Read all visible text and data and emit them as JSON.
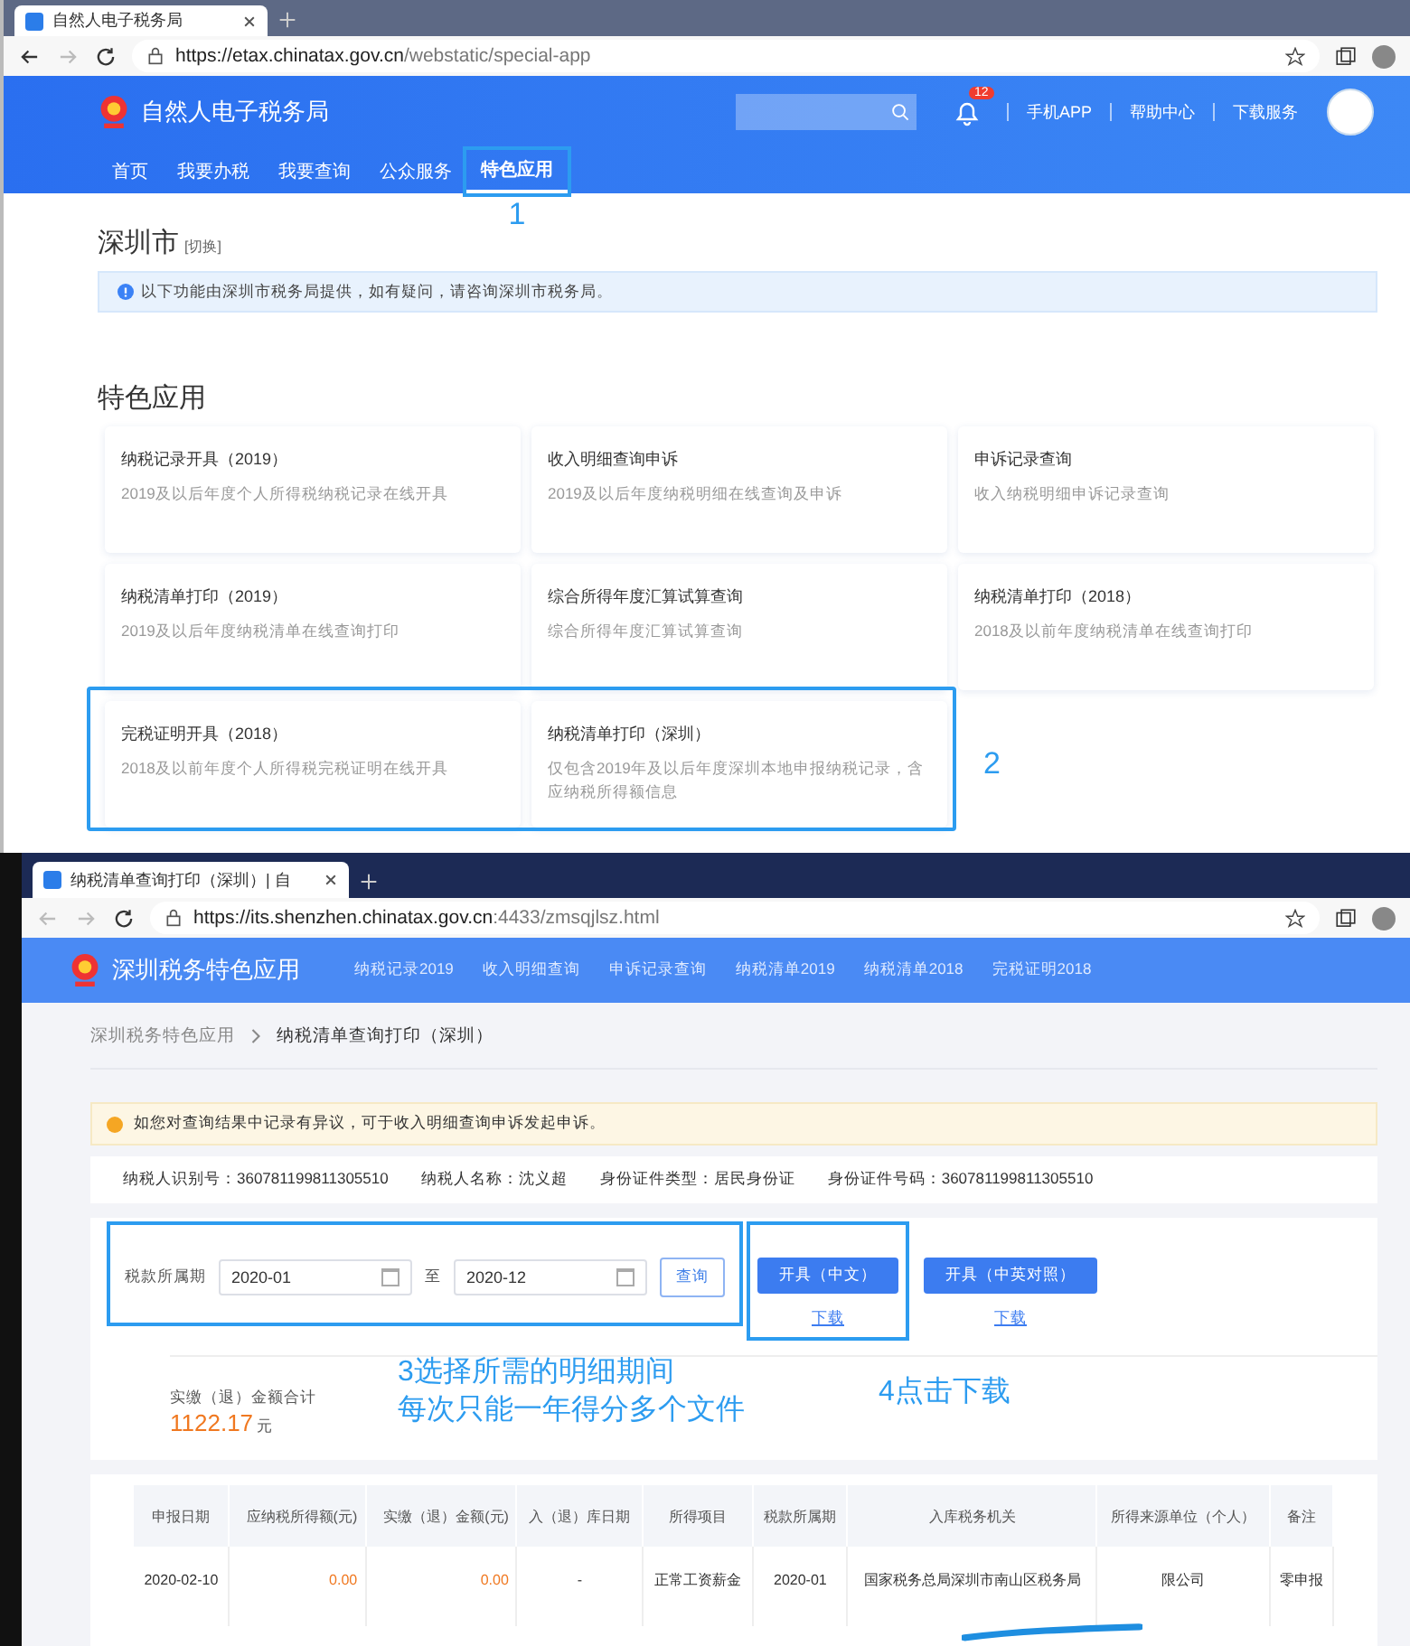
{
  "window_1": {
    "tab_title": "自然人电子税务局",
    "url_host": "https://etax.chinatax.gov.cn",
    "url_path": "/webstatic/special-app"
  },
  "site_1": {
    "title": "自然人电子税务局",
    "notification_count": "12",
    "links": [
      "手机APP",
      "帮助中心",
      "下载服务"
    ],
    "nav": [
      {
        "label": "首页",
        "selected": false,
        "highlighted": false
      },
      {
        "label": "我要办税",
        "selected": false,
        "highlighted": false
      },
      {
        "label": "我要查询",
        "selected": false,
        "highlighted": false
      },
      {
        "label": "公众服务",
        "selected": false,
        "highlighted": false
      },
      {
        "label": "特色应用",
        "selected": true,
        "highlighted": true
      }
    ]
  },
  "city": {
    "name": "深圳市",
    "switch": "[切换]"
  },
  "notice": "以下功能由深圳市税务局提供，如有疑问，请咨询深圳市税务局。",
  "section_title": "特色应用",
  "apps": [
    {
      "title": "纳税记录开具（2019）",
      "desc": "2019及以后年度个人所得税纳税记录在线开具",
      "highlighted": false
    },
    {
      "title": "收入明细查询申诉",
      "desc": "2019及以后年度纳税明细在线查询及申诉",
      "highlighted": false
    },
    {
      "title": "申诉记录查询",
      "desc": "收入纳税明细申诉记录查询",
      "highlighted": false
    },
    {
      "title": "纳税清单打印（2019）",
      "desc": "2019及以后年度纳税清单在线查询打印",
      "highlighted": false
    },
    {
      "title": "综合所得年度汇算试算查询",
      "desc": "综合所得年度汇算试算查询",
      "highlighted": false
    },
    {
      "title": "纳税清单打印（2018）",
      "desc": "2018及以前年度纳税清单在线查询打印",
      "highlighted": false
    },
    {
      "title": "完税证明开具（2018）",
      "desc": "2018及以前年度个人所得税完税证明在线开具",
      "highlighted": true
    },
    {
      "title": "纳税清单打印（深圳）",
      "desc": "仅包含2019年及以后年度深圳本地申报纳税记录，含应纳税所得额信息",
      "highlighted": true
    }
  ],
  "window_2": {
    "tab_title": "纳税清单查询打印（深圳）| 自",
    "url_host": "https://its.shenzhen.chinatax.gov.cn",
    "url_path": ":4433/zmsqjlsz.html"
  },
  "site_2": {
    "title": "深圳税务特色应用",
    "nav": [
      "纳税记录2019",
      "收入明细查询",
      "申诉记录查询",
      "纳税清单2019",
      "纳税清单2018",
      "完税证明2018"
    ]
  },
  "breadcrumb": [
    "深圳税务特色应用",
    "纳税清单查询打印（深圳）"
  ],
  "warning": "如您对查询结果中记录有异议，可于收入明细查询申诉发起申诉。",
  "taxpayer": [
    {
      "label": "纳税人识别号：",
      "value": "360781199811305510"
    },
    {
      "label": "纳税人名称：",
      "value": "沈义超"
    },
    {
      "label": "身份证件类型：",
      "value": "居民身份证"
    },
    {
      "label": "身份证件号码：",
      "value": "360781199811305510"
    }
  ],
  "form": {
    "label": "税款所属期",
    "from": "2020-01",
    "separator": "至",
    "to": "2020-12",
    "query_button": "查询",
    "highlighted": true,
    "actions": [
      {
        "button": "开具（中文）",
        "link": "下载",
        "highlighted": true
      },
      {
        "button": "开具（中英对照）",
        "link": "下载",
        "highlighted": false
      }
    ]
  },
  "summary": {
    "label": "实缴（退）金额合计",
    "amount": "1122.17",
    "unit": "元"
  },
  "annotations": {
    "nav": "1",
    "apps": "2",
    "period": [
      "3选择所需的明细期间",
      "每次只能一年得分多个文件"
    ],
    "download": "4点击下载"
  },
  "table": {
    "columns": [
      "申报日期",
      "应纳税所得额(元)",
      "实缴（退）金额(元)",
      "入（退）库日期",
      "所得项目",
      "税款所属期",
      "入库税务机关",
      "所得来源单位（个人）",
      "备注"
    ],
    "rows": [
      {
        "cells": [
          "2020-02-10",
          "0.00",
          "0.00",
          "-",
          "正常工资薪金",
          "2020-01",
          "国家税务总局深圳市南山区税务局",
          "限公司",
          "零申报"
        ],
        "redacted": true
      }
    ]
  }
}
